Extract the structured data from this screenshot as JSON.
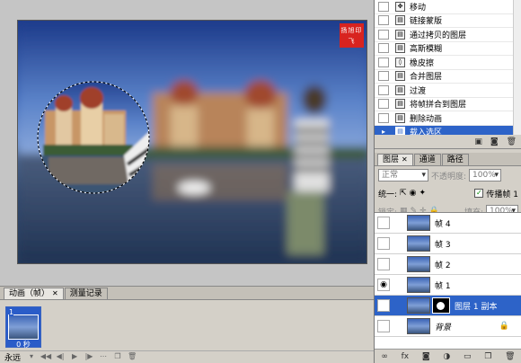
{
  "watermark": {
    "text": "扬旭印飞",
    "color": "#d8231f"
  },
  "history": {
    "items": [
      {
        "label": "移动",
        "icon": "move-icon",
        "selected": false
      },
      {
        "label": "链接蒙版",
        "icon": "history-state-icon",
        "selected": false
      },
      {
        "label": "通过拷贝的图层",
        "icon": "history-state-icon",
        "selected": false
      },
      {
        "label": "高斯模糊",
        "icon": "history-state-icon",
        "selected": false
      },
      {
        "label": "橡皮擦",
        "icon": "eraser-icon",
        "selected": false
      },
      {
        "label": "合并图层",
        "icon": "history-state-icon",
        "selected": false
      },
      {
        "label": "过渡",
        "icon": "history-state-icon",
        "selected": false
      },
      {
        "label": "将帧拼合到图层",
        "icon": "history-state-icon",
        "selected": false
      },
      {
        "label": "删除动画",
        "icon": "history-state-icon",
        "selected": false
      },
      {
        "label": "载入选区",
        "icon": "history-state-icon",
        "selected": true
      }
    ]
  },
  "layers_panel": {
    "tabs": [
      "图层",
      "通道",
      "路径"
    ],
    "blend_mode": "正常",
    "opacity_label": "不透明度:",
    "opacity_value": "100%",
    "unify_label": "统一:",
    "propagate_label": "传播帧 1",
    "lock_label": "锁定:",
    "fill_label": "填充:",
    "fill_value": "100%",
    "layers": [
      {
        "name": "帧 4",
        "visible": false,
        "selected": false
      },
      {
        "name": "帧 3",
        "visible": false,
        "selected": false
      },
      {
        "name": "帧 2",
        "visible": false,
        "selected": false
      },
      {
        "name": "帧 1",
        "visible": true,
        "selected": false
      },
      {
        "name": "图层 1 副本",
        "visible": false,
        "selected": true,
        "has_mask": true
      },
      {
        "name": "背景",
        "visible": false,
        "selected": false,
        "locked": true
      }
    ]
  },
  "animation_panel": {
    "tabs": [
      "动画（帧）",
      "测量记录"
    ],
    "frame": {
      "number": "1",
      "delay": "0 秒"
    },
    "loop": "永远"
  },
  "colors": {
    "selection": "#2d63c8",
    "panel_bg": "#d4d0c8"
  }
}
